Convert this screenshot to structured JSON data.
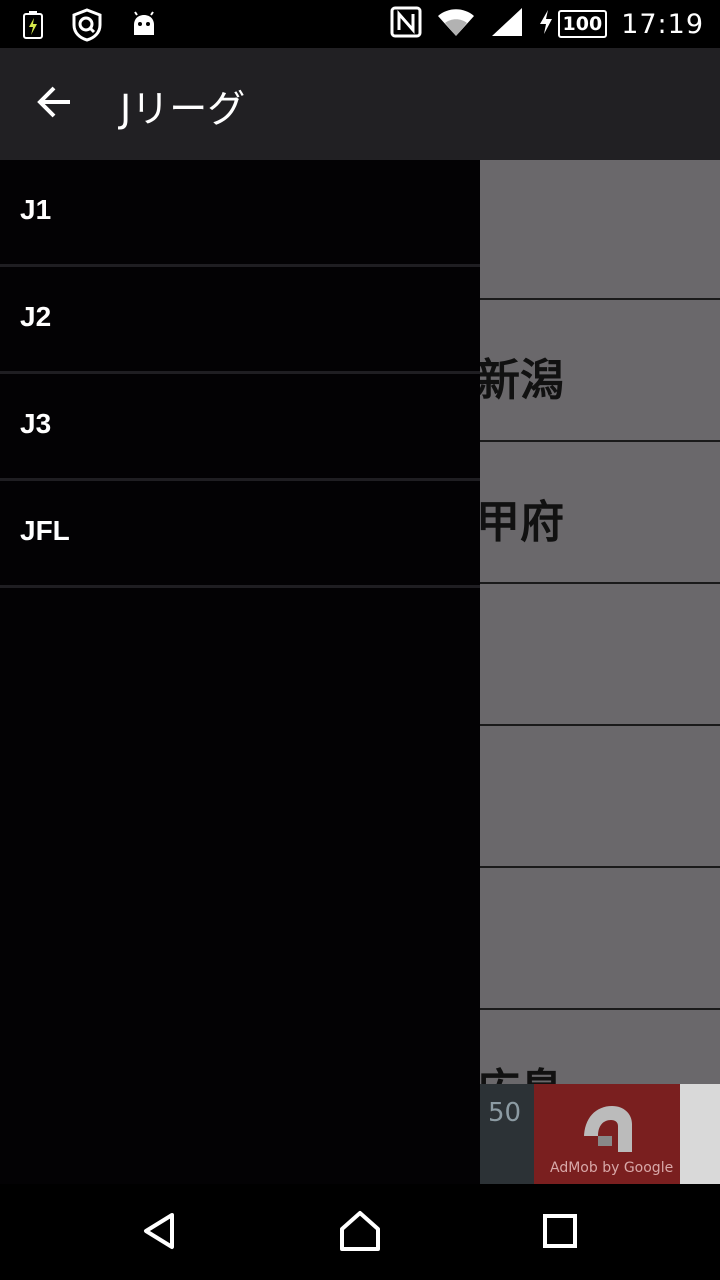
{
  "status_bar": {
    "time": "17:19",
    "battery_level": "100",
    "icons": [
      "battery-charging-icon",
      "shield-search-icon",
      "android-icon",
      "nfc-icon",
      "wifi-icon",
      "cell-signal-icon",
      "charging-bolt-icon"
    ]
  },
  "app_bar": {
    "title": "Jリーグ",
    "back_icon": "arrow-left-icon"
  },
  "drawer": {
    "items": [
      {
        "label": "J1"
      },
      {
        "label": "J2"
      },
      {
        "label": "J3"
      },
      {
        "label": "JFL"
      }
    ]
  },
  "background_list": {
    "rows": [
      {
        "text": ""
      },
      {
        "text": "新潟"
      },
      {
        "text": "甲府"
      },
      {
        "text": ""
      },
      {
        "text": ""
      },
      {
        "text": ""
      },
      {
        "text": "広島"
      }
    ]
  },
  "ad": {
    "number": "50",
    "label": "AdMob by Google"
  },
  "nav_bar": {
    "icons": [
      "back-triangle-icon",
      "home-icon",
      "recents-square-icon"
    ]
  },
  "colors": {
    "app_bar": "#212023",
    "drawer": "#030204",
    "content": "#6a686b",
    "ad_red": "#7a1f1f"
  }
}
